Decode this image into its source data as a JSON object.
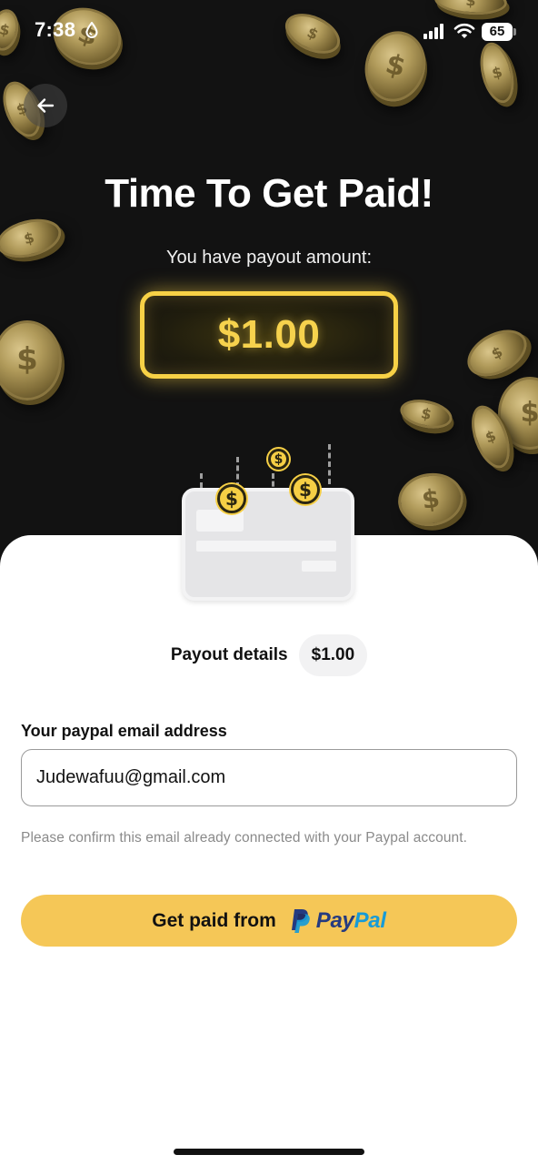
{
  "status_bar": {
    "time": "7:38",
    "battery": "65",
    "icons": [
      "drop-icon",
      "signal-icon",
      "wifi-icon",
      "battery-icon"
    ]
  },
  "header": {
    "back_icon": "arrow-left-icon",
    "title": "Time To Get Paid!",
    "subtitle": "You have payout amount:",
    "amount": "$1.00"
  },
  "illustration": {
    "coin_symbol": "$"
  },
  "payout": {
    "label": "Payout details",
    "value": "$1.00"
  },
  "form": {
    "email_label": "Your paypal email address",
    "email_value": "Judewafuu@gmail.com",
    "hint": "Please confirm this email already connected with your Paypal account."
  },
  "cta": {
    "label": "Get paid from",
    "brand_part1": "Pay",
    "brand_part2": "Pal",
    "brand_icon": "paypal-logo-icon"
  },
  "colors": {
    "background_dark": "#121212",
    "accent_gold": "#f6d24d",
    "button_yellow": "#f5c757",
    "paypal_dark_blue": "#253b80",
    "paypal_light_blue": "#179bd7"
  }
}
